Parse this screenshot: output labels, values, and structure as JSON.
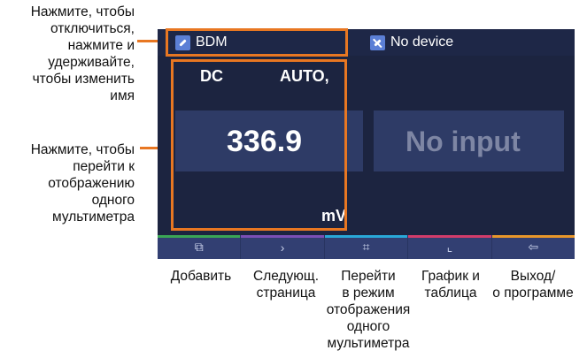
{
  "annotations": {
    "rename": [
      "Нажмите, чтобы",
      "отключиться,",
      "нажмите и",
      "удерживайте,",
      "чтобы изменить",
      "имя"
    ],
    "single_view": [
      "Нажмите, чтобы",
      "перейти к",
      "отображению",
      "одного",
      "мультиметра"
    ]
  },
  "status_bar": {
    "device1": "BDM",
    "device2": "No device",
    "device1_icon": "link-icon",
    "device2_icon": "link-off-icon"
  },
  "meter1": {
    "mode": "DC",
    "range": "AUTO,",
    "reading": "336.9",
    "unit": "mV"
  },
  "meter2": {
    "reading": "No input"
  },
  "toolbar": {
    "buttons": [
      {
        "icon": "add-device-icon",
        "glyph": "⧉",
        "accent": "#3aa655"
      },
      {
        "icon": "next-page-icon",
        "glyph": "›",
        "accent": "#7b4fb5"
      },
      {
        "icon": "single-view-icon",
        "glyph": "⌗",
        "accent": "#29a8d8"
      },
      {
        "icon": "graph-icon",
        "glyph": "⌞",
        "accent": "#d23c6a"
      },
      {
        "icon": "exit-icon",
        "glyph": "⇦",
        "accent": "#e8962a"
      }
    ]
  },
  "captions": {
    "add": "Добавить",
    "next": [
      "Следующ.",
      "страница"
    ],
    "single": [
      "Перейти",
      "в режим",
      "отображения",
      "одного",
      "мультиметра"
    ],
    "graph": [
      "График и",
      "таблица"
    ],
    "exit": [
      "Выход/",
      "о программе"
    ]
  },
  "colors": {
    "highlight": "#e87722",
    "screen_bg": "#1c2440",
    "reading_band": "#2e3b66"
  }
}
